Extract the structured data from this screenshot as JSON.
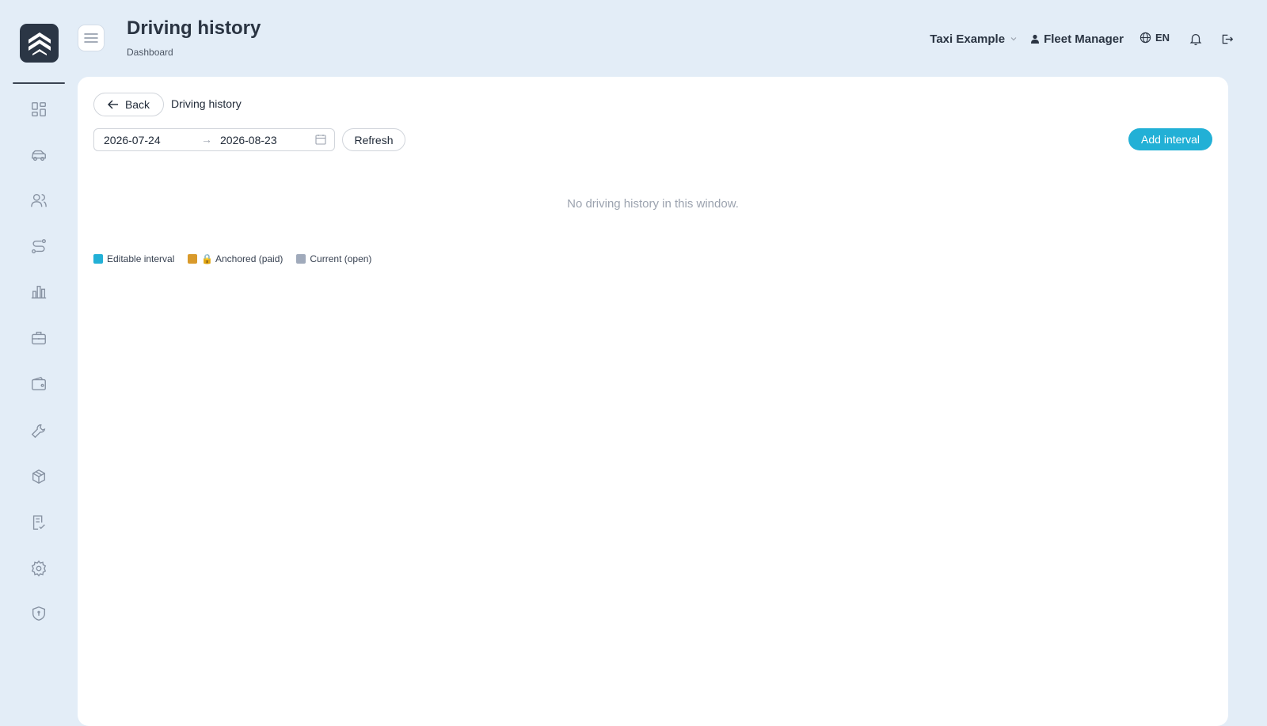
{
  "header": {
    "title": "Driving history",
    "subtitle": "Dashboard",
    "company": "Taxi Example",
    "user": "Fleet Manager",
    "language": "EN"
  },
  "sidebar": {
    "items": [
      {
        "icon": "dashboard-icon"
      },
      {
        "icon": "car-icon"
      },
      {
        "icon": "users-icon"
      },
      {
        "icon": "route-icon"
      },
      {
        "icon": "bar-chart-icon"
      },
      {
        "icon": "briefcase-icon"
      },
      {
        "icon": "wallet-icon"
      },
      {
        "icon": "wrench-icon"
      },
      {
        "icon": "package-icon"
      },
      {
        "icon": "checklist-icon"
      },
      {
        "icon": "settings-icon"
      },
      {
        "icon": "shield-icon"
      }
    ]
  },
  "toolbar": {
    "back_label": "Back",
    "breadcrumb": "Driving history",
    "date_from": "2026-07-24",
    "date_to": "2026-08-23",
    "refresh_label": "Refresh",
    "add_label": "Add interval"
  },
  "main": {
    "empty_message": "No driving history in this window."
  },
  "legend": [
    {
      "label": "Editable interval",
      "color": "#22b0d6"
    },
    {
      "label": "🔒 Anchored (paid)",
      "color": "#d99a2b"
    },
    {
      "label": "Current (open)",
      "color": "#a0aabb"
    }
  ],
  "colors": {
    "accent": "#22b0d6",
    "background": "#e3edf7",
    "panel": "#ffffff"
  }
}
